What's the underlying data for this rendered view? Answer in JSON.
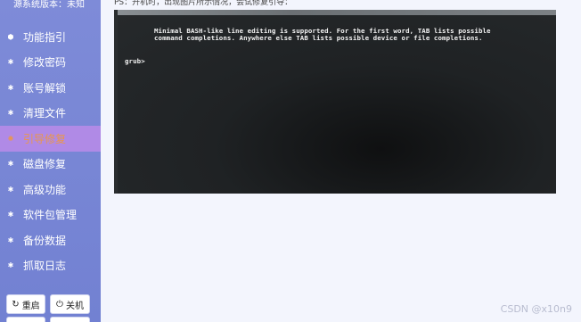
{
  "sidebar": {
    "system_version": "源系统版本：未知",
    "items": [
      {
        "label": "功能指引",
        "icon": "shield-icon"
      },
      {
        "label": "修改密码",
        "icon": "star-icon"
      },
      {
        "label": "账号解锁",
        "icon": "star-icon"
      },
      {
        "label": "清理文件",
        "icon": "star-icon"
      },
      {
        "label": "引导修复",
        "icon": "sun-icon",
        "active": true
      },
      {
        "label": "磁盘修复",
        "icon": "star-icon"
      },
      {
        "label": "高级功能",
        "icon": "star-icon"
      },
      {
        "label": "软件包管理",
        "icon": "star-icon"
      },
      {
        "label": "备份数据",
        "icon": "star-icon"
      },
      {
        "label": "抓取日志",
        "icon": "star-icon"
      }
    ],
    "buttons": {
      "restart_label": "重启",
      "shutdown_label": "关机"
    }
  },
  "main": {
    "ps_note": "PS：开机时，出现图片所示情况，会试修复引导：",
    "terminal": {
      "line1": "Minimal BASH-like line editing is supported. For the first word, TAB lists possible",
      "line2": "command completions. Anywhere else TAB lists possible device or file completions.",
      "prompt": "grub>"
    },
    "watermark": "CSDN @x10n9"
  },
  "colors": {
    "sidebar_bg": "#7a87d6",
    "active_bg": "#b08ae6",
    "active_text": "#e9964e",
    "main_bg": "#f3f5fd"
  }
}
